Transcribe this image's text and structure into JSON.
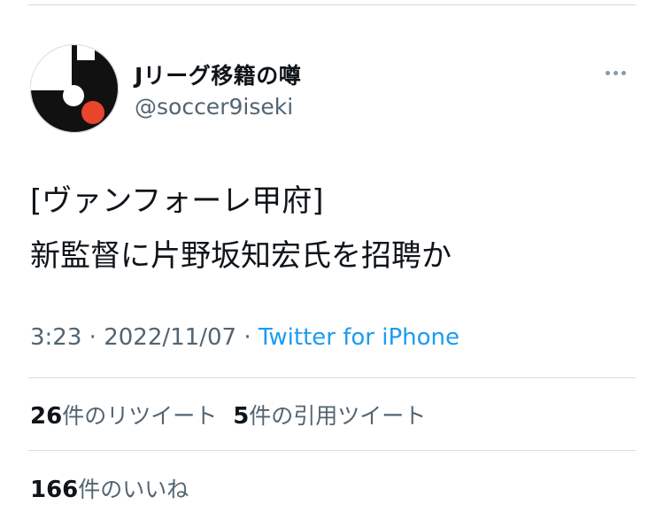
{
  "tweet": {
    "display_name": "Jリーグ移籍の噂",
    "handle": "@soccer9iseki",
    "text_line1": "[ヴァンフォーレ甲府]",
    "text_line2": "新監督に片野坂知宏氏を招聘か",
    "time": "3:23",
    "date": "2022/11/07",
    "separator": "·",
    "source": "Twitter for iPhone",
    "retweet_count": "26",
    "retweet_label": "件のリツイート",
    "quote_count": "5",
    "quote_label": "件の引用ツイート",
    "like_count": "166",
    "like_label": "件のいいね"
  },
  "icons": {
    "avatar": "j-league-logo-avatar",
    "more": "more-options-icon"
  },
  "colors": {
    "link": "#1d9bf0",
    "secondary_text": "#536471",
    "avatar_accent": "#e8452c"
  }
}
